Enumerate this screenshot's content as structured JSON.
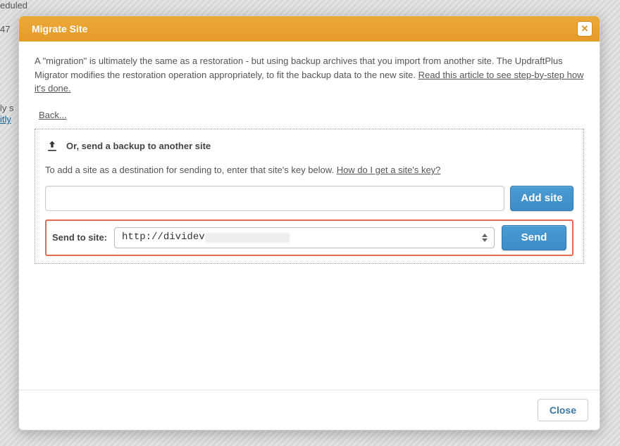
{
  "background": {
    "fragment1": "eduled",
    "fragment2": "47",
    "fragment3": "ly s",
    "fragment4_link": "itly"
  },
  "dialog": {
    "title": "Migrate Site",
    "intro_part1": "A \"migration\" is ultimately the same as a restoration - but using backup archives that you import from another site. The UpdraftPlus Migrator modifies the restoration operation appropriately, to fit the backup data to the new site. ",
    "intro_link": "Read this article to see step-by-step how it's done.",
    "back_label": "Back...",
    "panel": {
      "heading": "Or, send a backup to another site",
      "desc_text": "To add a site as a destination for sending to, enter that site's key below. ",
      "desc_link": "How do I get a site's key?",
      "key_input_value": "",
      "add_button": "Add site",
      "send_to_label": "Send to site:",
      "selected_site": "http://dividev",
      "send_button": "Send"
    },
    "close_button": "Close"
  }
}
